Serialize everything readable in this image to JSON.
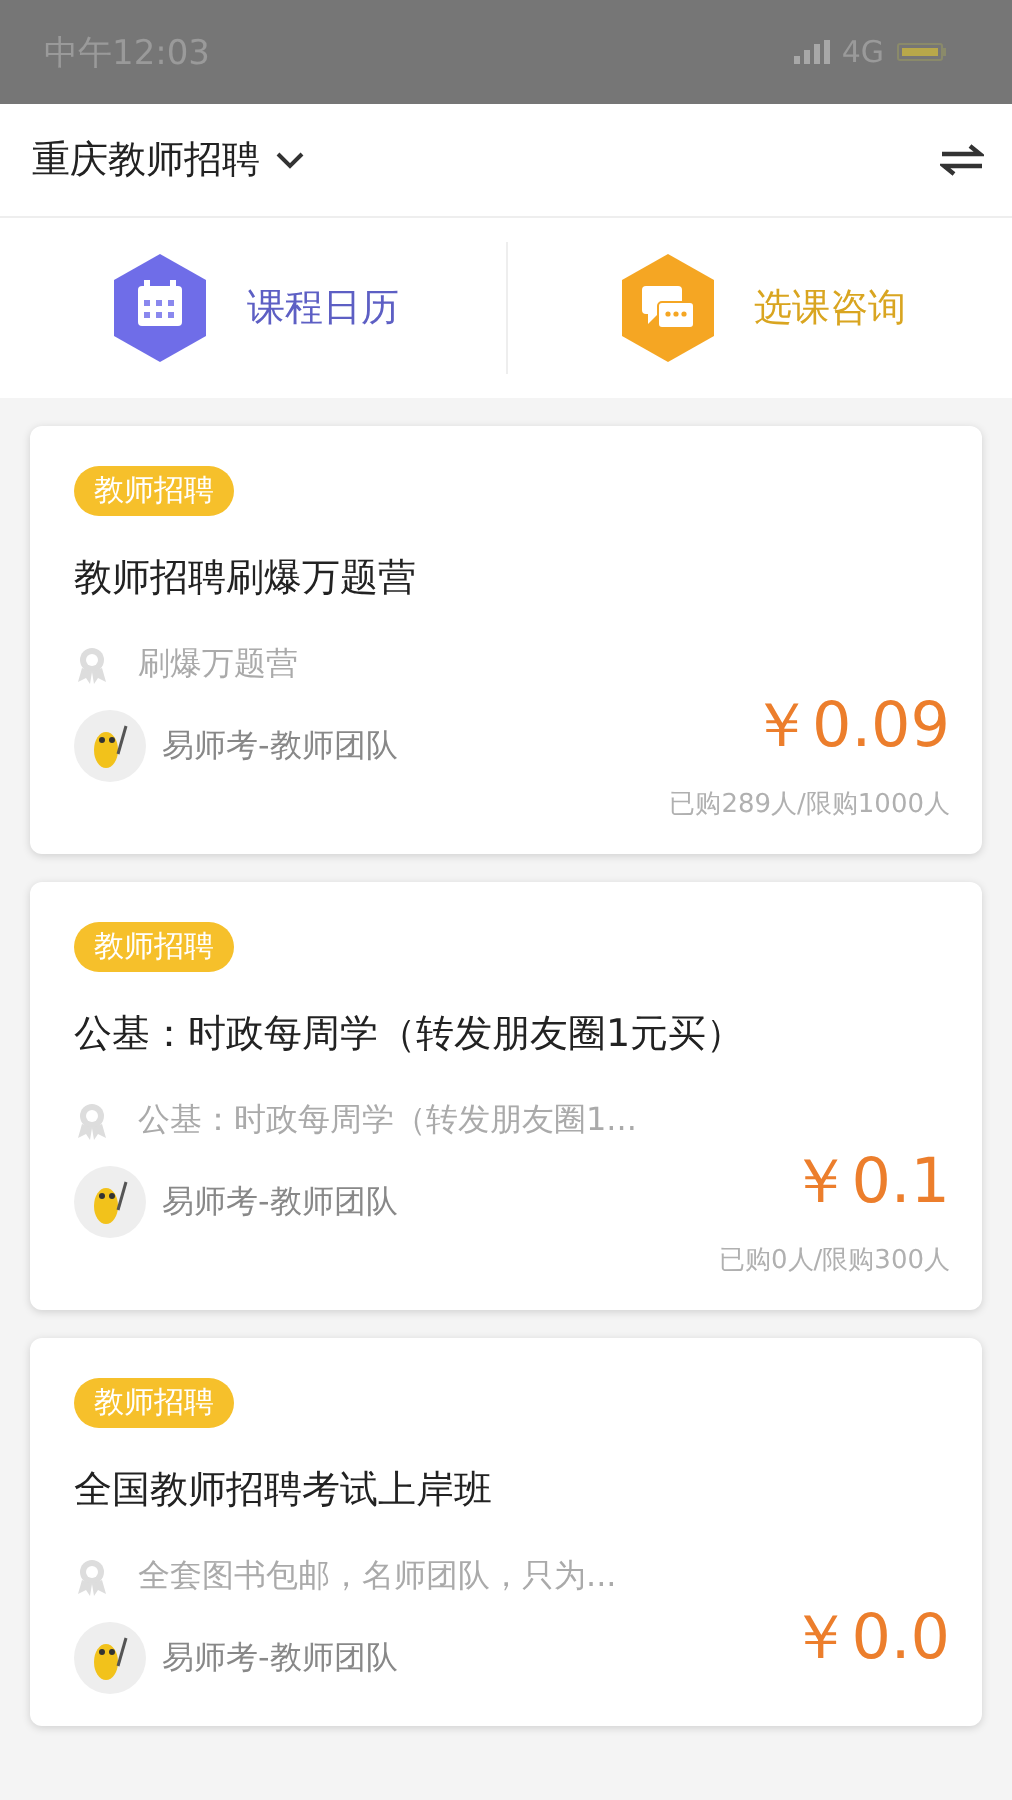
{
  "status_bar": {
    "time": "中午12:03",
    "network": "4G"
  },
  "header": {
    "title": "重庆教师招聘"
  },
  "shortcuts": [
    {
      "label": "课程日历",
      "kind": "calendar"
    },
    {
      "label": "选课咨询",
      "kind": "chat"
    }
  ],
  "courses": [
    {
      "tag": "教师招聘",
      "title": "教师招聘刷爆万题营",
      "subtitle": "刷爆万题营",
      "author": "易师考-教师团队",
      "price": "￥0.09",
      "sold": "已购289人/限购1000人"
    },
    {
      "tag": "教师招聘",
      "title": "公基：时政每周学（转发朋友圈1元买）",
      "subtitle": "公基：时政每周学（转发朋友圈1...",
      "author": "易师考-教师团队",
      "price": "￥0.1",
      "sold": "已购0人/限购300人"
    },
    {
      "tag": "教师招聘",
      "title": "全国教师招聘考试上岸班",
      "subtitle": "全套图书包邮，名师团队，只为...",
      "author": "易师考-教师团队",
      "price": "￥0.0"
    }
  ]
}
